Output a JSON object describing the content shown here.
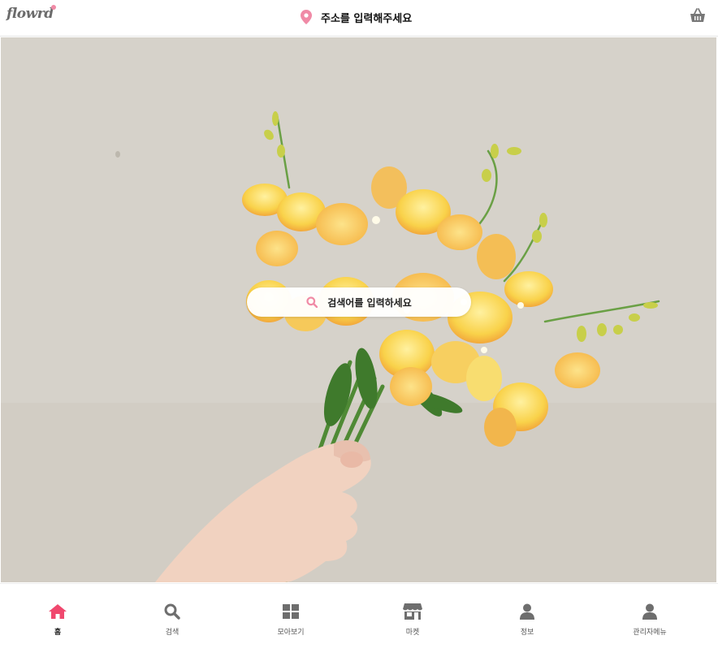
{
  "header": {
    "logo_text": "flowrd",
    "address_placeholder": "주소를 입력해주세요"
  },
  "hero": {
    "search_placeholder": "검색어를 입력하세요"
  },
  "bottom_nav": {
    "items": [
      {
        "label": "홈",
        "icon": "home-icon",
        "active": true
      },
      {
        "label": "검색",
        "icon": "search-icon",
        "active": false
      },
      {
        "label": "모아보기",
        "icon": "grid-icon",
        "active": false
      },
      {
        "label": "마켓",
        "icon": "store-icon",
        "active": false
      },
      {
        "label": "정보",
        "icon": "person-icon",
        "active": false
      },
      {
        "label": "관리자메뉴",
        "icon": "admin-icon",
        "active": false
      }
    ]
  },
  "colors": {
    "accent": "#f0486e",
    "pin": "#f08aa6",
    "inactive_icon": "#6e6e6e"
  }
}
